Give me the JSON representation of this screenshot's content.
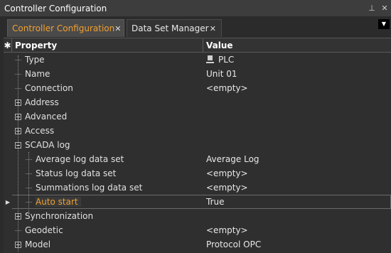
{
  "window": {
    "title": "Controller Configuration",
    "pin_glyph": "⊥",
    "close_glyph": "✕"
  },
  "tabs": [
    {
      "label": "Controller Configuration",
      "active": true
    },
    {
      "label": "Data Set Manager",
      "active": false
    }
  ],
  "tab_menu_glyph": "▼",
  "tab_close_glyph": "✕",
  "grid": {
    "selector_header": "✱",
    "col_property": "Property",
    "col_value": "Value",
    "row_indicator": "▶",
    "rows": [
      {
        "name": "Type",
        "value": "PLC",
        "value_icon": "plc-device-icon",
        "expander": "none",
        "level": 0
      },
      {
        "name": "Name",
        "value": "Unit 01",
        "expander": "none",
        "level": 0
      },
      {
        "name": "Connection",
        "value": "<empty>",
        "expander": "none",
        "level": 0
      },
      {
        "name": "Address",
        "value": "",
        "expander": "plus",
        "level": 0
      },
      {
        "name": "Advanced",
        "value": "",
        "expander": "plus",
        "level": 0
      },
      {
        "name": "Access",
        "value": "",
        "expander": "plus",
        "level": 0
      },
      {
        "name": "SCADA log",
        "value": "",
        "expander": "minus",
        "level": 0
      },
      {
        "name": "Average log data set",
        "value": "Average Log",
        "expander": "none",
        "level": 1
      },
      {
        "name": "Status log data set",
        "value": "<empty>",
        "expander": "none",
        "level": 1
      },
      {
        "name": "Summations log data set",
        "value": "<empty>",
        "expander": "none",
        "level": 1
      },
      {
        "name": "Auto start",
        "value": "True",
        "expander": "none",
        "level": 1,
        "selected": true
      },
      {
        "name": "Synchronization",
        "value": "",
        "expander": "plus",
        "level": 0
      },
      {
        "name": "Geodetic",
        "value": "<empty>",
        "expander": "none",
        "level": 0
      },
      {
        "name": "Model",
        "value": "Protocol OPC",
        "expander": "plus",
        "level": 0
      }
    ]
  },
  "colors": {
    "background": "#2b2b2b",
    "accent": "#f0a030",
    "text": "#e0e0e0"
  }
}
